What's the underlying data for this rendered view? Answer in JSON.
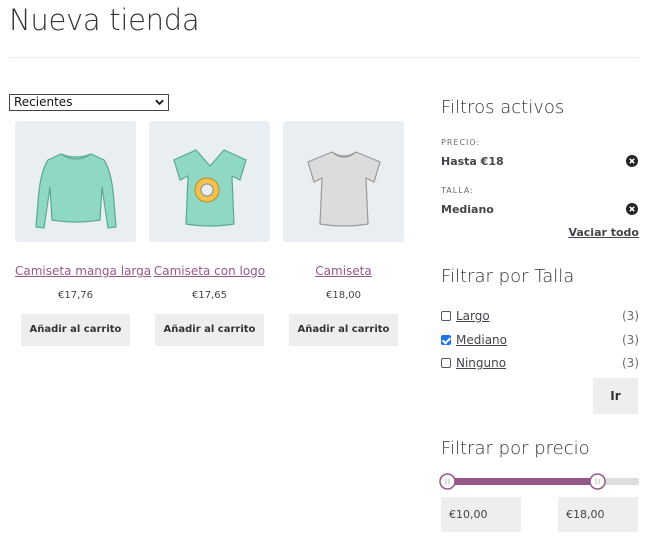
{
  "page": {
    "title": "Nueva tienda"
  },
  "sort": {
    "selected": "Recientes"
  },
  "products": [
    {
      "name": "Camiseta manga larga",
      "price": "€17,76",
      "button": "Añadir al carrito",
      "icon": "long-sleeve-shirt-icon"
    },
    {
      "name": "Camiseta con logo",
      "price": "€17,65",
      "button": "Añadir al carrito",
      "icon": "logo-tshirt-icon"
    },
    {
      "name": "Camiseta",
      "price": "€18,00",
      "button": "Añadir al carrito",
      "icon": "tshirt-icon"
    }
  ],
  "active_filters": {
    "title": "Filtros activos",
    "price_label": "PRECIO:",
    "price_value": "Hasta €18",
    "size_label": "TALLA:",
    "size_value": "Mediano",
    "clear_all": "Vaciar todo"
  },
  "size_filter": {
    "title": "Filtrar por Talla",
    "options": [
      {
        "label": "Largo",
        "count": "(3)",
        "checked": false
      },
      {
        "label": "Mediano",
        "count": "(3)",
        "checked": true
      },
      {
        "label": "Ninguno",
        "count": "(3)",
        "checked": false
      }
    ],
    "apply": "Ir"
  },
  "price_filter": {
    "title": "Filtrar por precio",
    "min": "€10,00",
    "max": "€18,00",
    "range_fraction": [
      0.0,
      0.78
    ]
  },
  "colors": {
    "accent": "#96588a",
    "teal_shirt": "#8fd8c3",
    "grey_shirt": "#dcdcdc",
    "thumb_bg": "#e9eef2"
  }
}
